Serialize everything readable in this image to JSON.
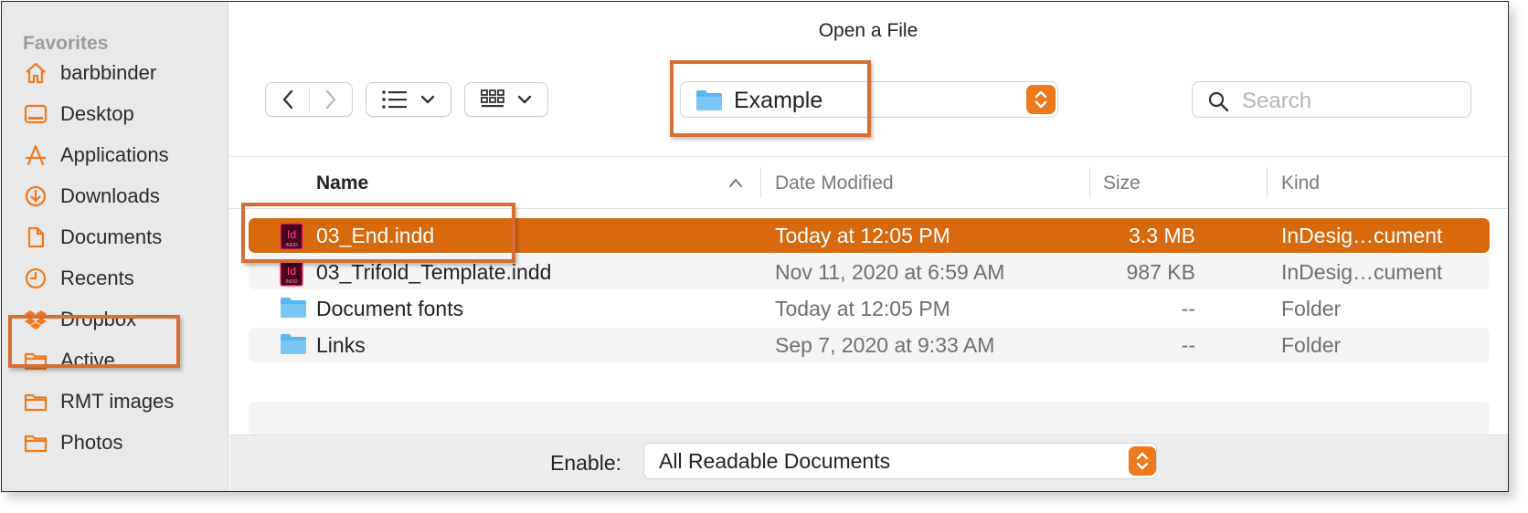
{
  "window": {
    "title": "Open a File"
  },
  "sidebar": {
    "header": "Favorites",
    "items": [
      {
        "label": "barbbinder",
        "icon": "home-icon"
      },
      {
        "label": "Desktop",
        "icon": "desktop-icon"
      },
      {
        "label": "Applications",
        "icon": "applications-icon"
      },
      {
        "label": "Downloads",
        "icon": "download-icon"
      },
      {
        "label": "Documents",
        "icon": "document-icon"
      },
      {
        "label": "Recents",
        "icon": "clock-icon"
      },
      {
        "label": "Dropbox",
        "icon": "dropbox-icon"
      },
      {
        "label": "Active",
        "icon": "folder-icon"
      },
      {
        "label": "RMT images",
        "icon": "folder-icon"
      },
      {
        "label": "Photos",
        "icon": "folder-icon"
      }
    ]
  },
  "toolbar": {
    "location": "Example",
    "search_placeholder": "Search"
  },
  "columns": {
    "name": "Name",
    "date": "Date Modified",
    "size": "Size",
    "kind": "Kind"
  },
  "files": [
    {
      "name": "03_End.indd",
      "date": "Today at 12:05 PM",
      "size": "3.3 MB",
      "kind": "InDesig…cument",
      "type": "indd"
    },
    {
      "name": "03_Trifold_Template.indd",
      "date": "Nov 11, 2020 at 6:59 AM",
      "size": "987 KB",
      "kind": "InDesig…cument",
      "type": "indd"
    },
    {
      "name": "Document fonts",
      "date": "Today at 12:05 PM",
      "size": "--",
      "kind": "Folder",
      "type": "folder"
    },
    {
      "name": "Links",
      "date": "Sep 7, 2020 at 9:33 AM",
      "size": "--",
      "kind": "Folder",
      "type": "folder"
    }
  ],
  "footer": {
    "enable_label": "Enable:",
    "enable_value": "All Readable Documents"
  },
  "colors": {
    "accent": "#ef7a1e",
    "selection": "#d76a0f",
    "highlight": "#d76d35",
    "folder": "#5ab6f0"
  },
  "icons": {
    "indd": "Id",
    "indd_sub": "INDD"
  }
}
